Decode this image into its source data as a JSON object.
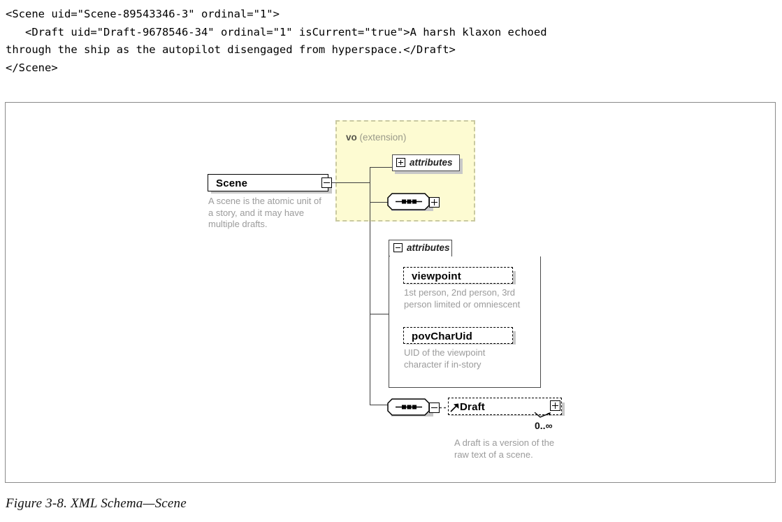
{
  "code_block": {
    "language": "xml",
    "lines": [
      "<Scene uid=\"Scene-89543346-3\" ordinal=\"1\">",
      "   <Draft uid=\"Draft-9678546-34\" ordinal=\"1\" isCurrent=\"true\">A harsh klaxon echoed",
      "through the ship as the autopilot disengaged from hyperspace.</Draft>",
      "</Scene>"
    ],
    "text": "<Scene uid=\"Scene-89543346-3\" ordinal=\"1\">\n   <Draft uid=\"Draft-9678546-34\" ordinal=\"1\" isCurrent=\"true\">A harsh klaxon echoed\nthrough the ship as the autopilot disengaged from hyperspace.</Draft>\n</Scene>"
  },
  "figure": {
    "caption": "Figure 3-8. XML Schema—Scene"
  },
  "diagram": {
    "type": "xml-schema",
    "root": {
      "name": "Scene",
      "toggle": "minus",
      "annotation": "A scene is the atomic unit of\na story, and it may have\nmultiple drafts."
    },
    "extension_region": {
      "prefix": "vo",
      "kind": "(extension)",
      "background": "#fdfbd2",
      "border": "#c9c9a0",
      "children": [
        {
          "kind": "attribute-group",
          "title": "attributes",
          "toggle": "plus"
        },
        {
          "kind": "sequence",
          "icon": "sequence-icon",
          "toggle": "plus"
        }
      ]
    },
    "attribute_group": {
      "title": "attributes",
      "toggle": "minus",
      "attributes": [
        {
          "name": "viewpoint",
          "annotation": "1st person, 2nd person, 3rd\nperson limited or omniescent"
        },
        {
          "name": "povCharUid",
          "annotation": "UID of the viewpoint\ncharacter if in-story"
        }
      ]
    },
    "sequence_branch": {
      "icon": "sequence-icon",
      "toggle": "minus",
      "element": {
        "name": "Draft",
        "toggle": "plus",
        "cardinality": "0..∞",
        "annotation": "A draft is a version of the\nraw text of a scene."
      }
    }
  }
}
